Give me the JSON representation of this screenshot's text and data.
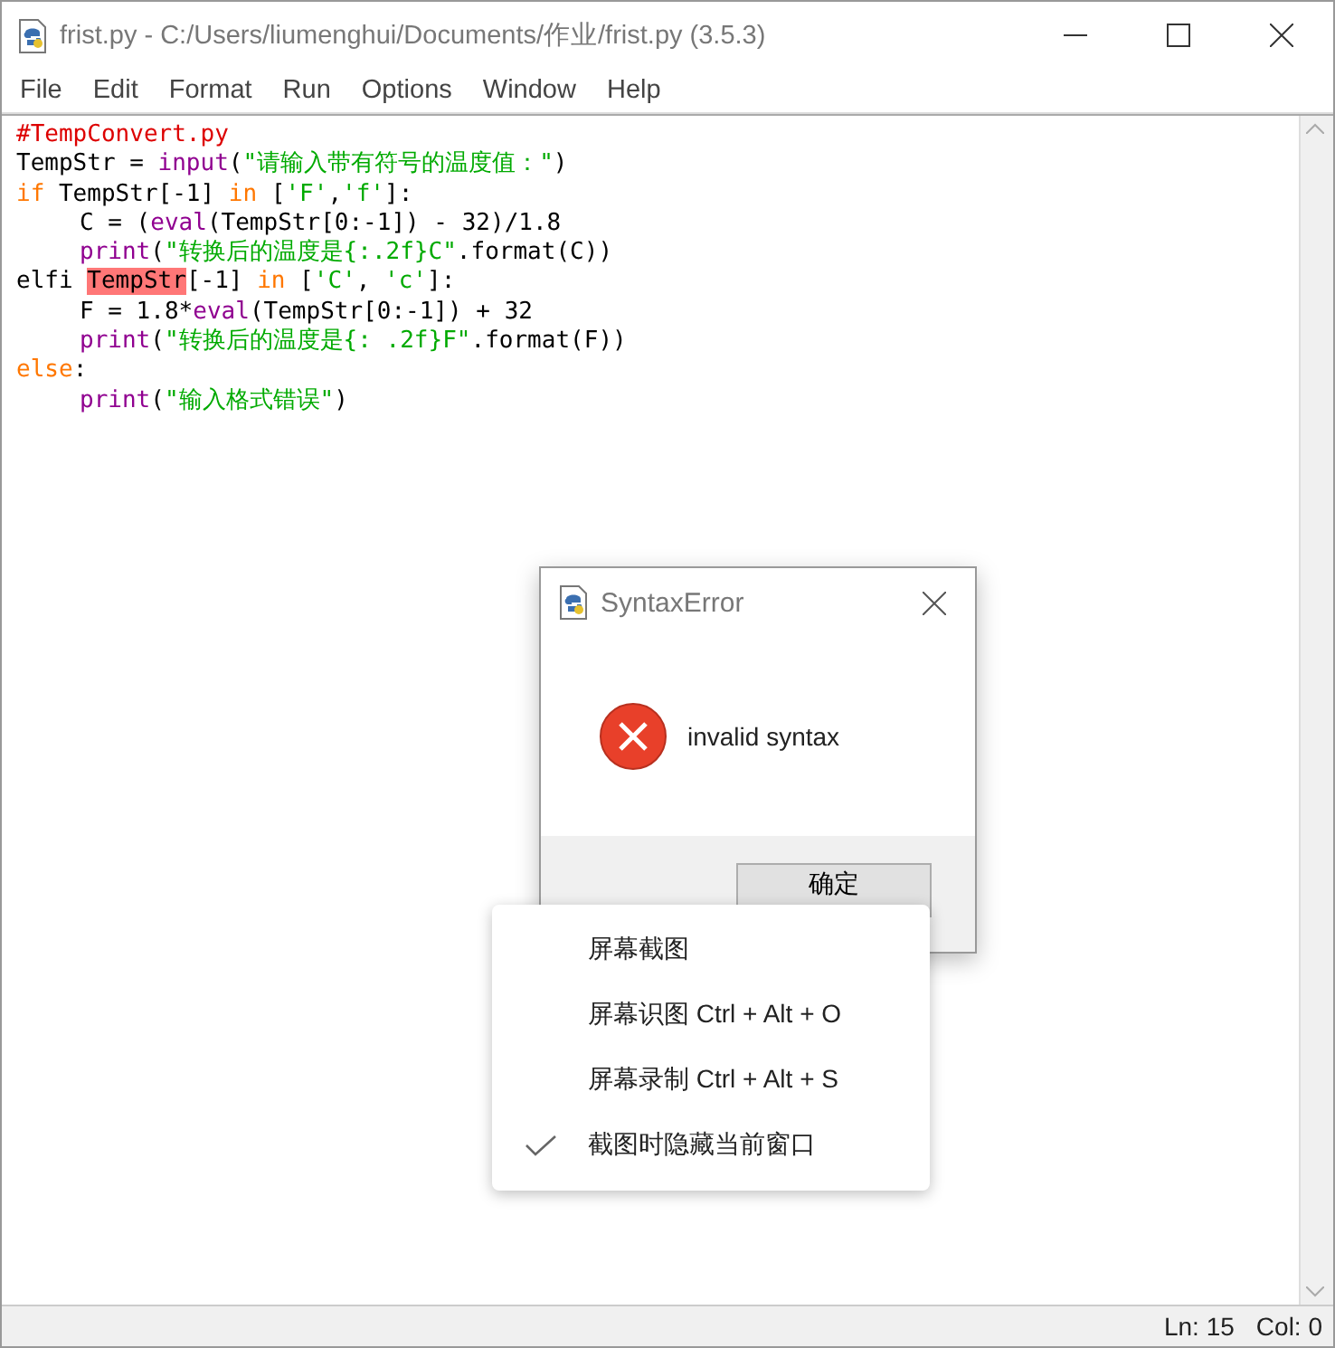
{
  "window": {
    "title": "frist.py - C:/Users/liumenghui/Documents/作业/frist.py (3.5.3)"
  },
  "menu": [
    "File",
    "Edit",
    "Format",
    "Run",
    "Options",
    "Window",
    "Help"
  ],
  "code": [
    {
      "indented": false,
      "tokens": [
        {
          "kind": "comment",
          "text": "#TempConvert.py"
        }
      ]
    },
    {
      "indented": false,
      "tokens": [
        {
          "kind": "plain",
          "text": "TempStr = "
        },
        {
          "kind": "builtin",
          "text": "input"
        },
        {
          "kind": "plain",
          "text": "("
        },
        {
          "kind": "string",
          "text": "\"请输入带有符号的温度值：\""
        },
        {
          "kind": "plain",
          "text": ")"
        }
      ]
    },
    {
      "indented": false,
      "tokens": [
        {
          "kind": "keyword",
          "text": "if"
        },
        {
          "kind": "plain",
          "text": " TempStr[-1] "
        },
        {
          "kind": "keyword",
          "text": "in"
        },
        {
          "kind": "plain",
          "text": " ["
        },
        {
          "kind": "string",
          "text": "'F'"
        },
        {
          "kind": "plain",
          "text": ","
        },
        {
          "kind": "string",
          "text": "'f'"
        },
        {
          "kind": "plain",
          "text": "]:"
        }
      ]
    },
    {
      "indented": true,
      "tokens": [
        {
          "kind": "plain",
          "text": "C = ("
        },
        {
          "kind": "builtin",
          "text": "eval"
        },
        {
          "kind": "plain",
          "text": "(TempStr[0:-1]) - 32)/1.8"
        }
      ]
    },
    {
      "indented": true,
      "tokens": [
        {
          "kind": "builtin",
          "text": "print"
        },
        {
          "kind": "plain",
          "text": "("
        },
        {
          "kind": "string",
          "text": "\"转换后的温度是{:.2f}C\""
        },
        {
          "kind": "plain",
          "text": ".format(C))"
        }
      ]
    },
    {
      "indented": false,
      "tokens": [
        {
          "kind": "plain",
          "text": "elfi "
        },
        {
          "kind": "error",
          "text": "TempStr"
        },
        {
          "kind": "plain",
          "text": "[-1] "
        },
        {
          "kind": "keyword",
          "text": "in"
        },
        {
          "kind": "plain",
          "text": " ["
        },
        {
          "kind": "string",
          "text": "'C'"
        },
        {
          "kind": "plain",
          "text": ", "
        },
        {
          "kind": "string",
          "text": "'c'"
        },
        {
          "kind": "plain",
          "text": "]:"
        }
      ]
    },
    {
      "indented": true,
      "tokens": [
        {
          "kind": "plain",
          "text": "F = 1.8*"
        },
        {
          "kind": "builtin",
          "text": "eval"
        },
        {
          "kind": "plain",
          "text": "(TempStr[0:-1]) + 32"
        }
      ]
    },
    {
      "indented": true,
      "tokens": [
        {
          "kind": "builtin",
          "text": "print"
        },
        {
          "kind": "plain",
          "text": "("
        },
        {
          "kind": "string",
          "text": "\"转换后的温度是{: .2f}F\""
        },
        {
          "kind": "plain",
          "text": ".format(F))"
        }
      ]
    },
    {
      "indented": false,
      "tokens": [
        {
          "kind": "keyword",
          "text": "else"
        },
        {
          "kind": "plain",
          "text": ":"
        }
      ]
    },
    {
      "indented": true,
      "tokens": [
        {
          "kind": "builtin",
          "text": "print"
        },
        {
          "kind": "plain",
          "text": "("
        },
        {
          "kind": "string",
          "text": "\"输入格式错误\""
        },
        {
          "kind": "plain",
          "text": ")"
        }
      ]
    }
  ],
  "dialog": {
    "title": "SyntaxError",
    "message": "invalid syntax",
    "button": "确定"
  },
  "context_menu": [
    {
      "label": "屏幕截图",
      "checked": false
    },
    {
      "label": "屏幕识图 Ctrl + Alt + O",
      "checked": false
    },
    {
      "label": "屏幕录制 Ctrl + Alt + S",
      "checked": false
    },
    {
      "label": "截图时隐藏当前窗口",
      "checked": true
    }
  ],
  "status_bar": {
    "line": "Ln: 15",
    "col": "Col: 0"
  }
}
